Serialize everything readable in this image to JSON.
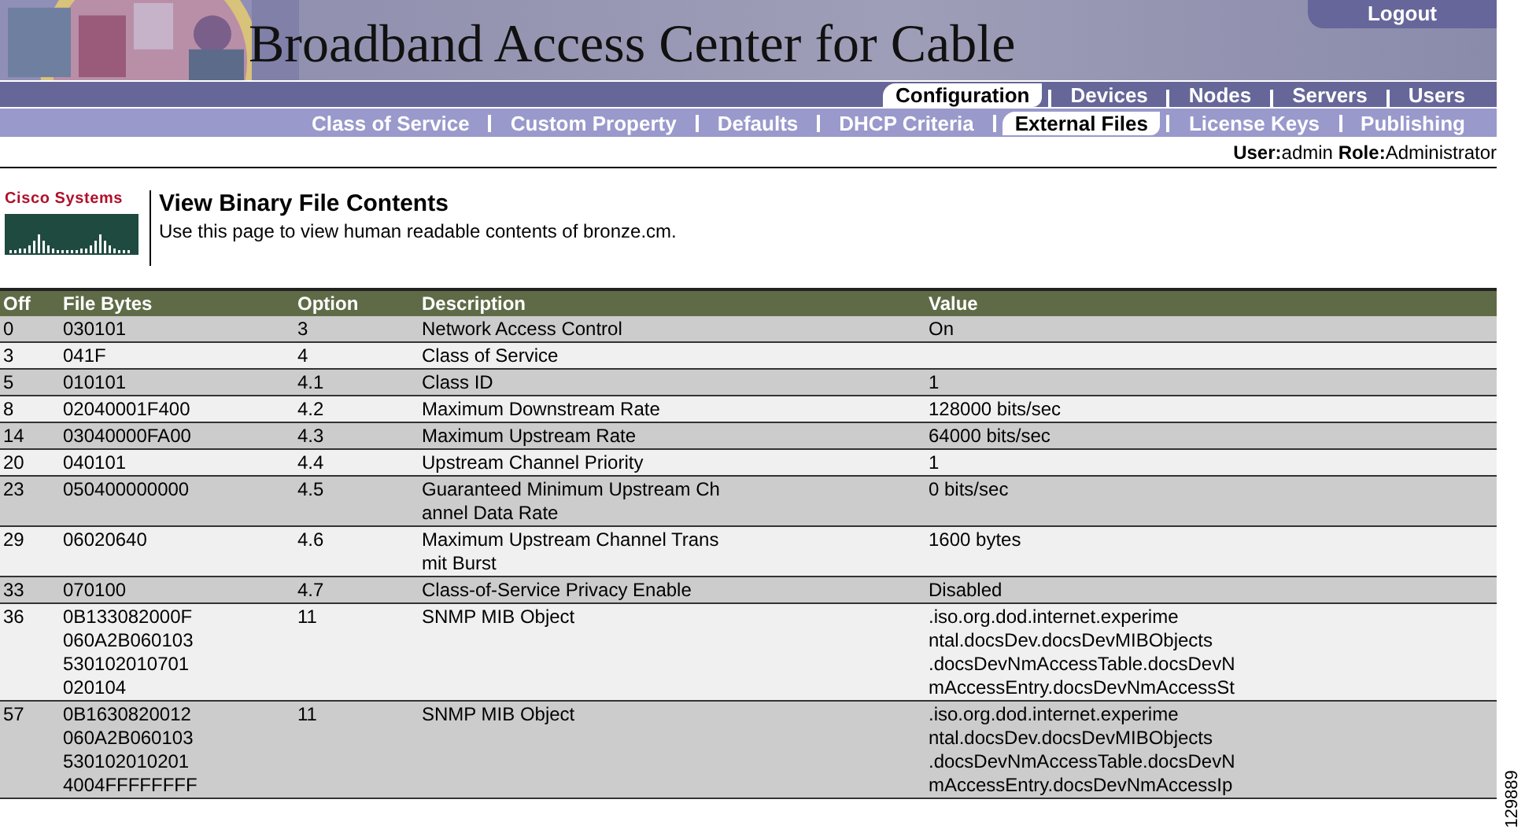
{
  "header": {
    "title": "Broadband Access Center for Cable",
    "logout": "Logout"
  },
  "main_tabs": [
    {
      "label": "Configuration",
      "selected": true
    },
    {
      "label": "Devices",
      "selected": false
    },
    {
      "label": "Nodes",
      "selected": false
    },
    {
      "label": "Servers",
      "selected": false
    },
    {
      "label": "Users",
      "selected": false
    }
  ],
  "sub_tabs": [
    {
      "label": "Class of Service",
      "selected": false
    },
    {
      "label": "Custom Property",
      "selected": false
    },
    {
      "label": "Defaults",
      "selected": false
    },
    {
      "label": "DHCP Criteria",
      "selected": false
    },
    {
      "label": "External Files",
      "selected": true
    },
    {
      "label": "License Keys",
      "selected": false
    },
    {
      "label": "Publishing",
      "selected": false
    }
  ],
  "user_line": {
    "user_label": "User:",
    "user": "admin",
    "role_label": "Role:",
    "role": "Administrator"
  },
  "logo": {
    "text": "Cisco Systems"
  },
  "page": {
    "title": "View Binary File Contents",
    "description": "Use this page to view human readable contents of bronze.cm."
  },
  "table": {
    "columns": [
      "Off",
      "File Bytes",
      "Option",
      "Description",
      "Value"
    ],
    "rows": [
      {
        "off": "0",
        "bytes": [
          "030101"
        ],
        "option": "3",
        "description": [
          "Network Access Control"
        ],
        "value": [
          "On"
        ]
      },
      {
        "off": "3",
        "bytes": [
          "041F"
        ],
        "option": "4",
        "description": [
          "Class of Service"
        ],
        "value": []
      },
      {
        "off": "5",
        "bytes": [
          "010101"
        ],
        "option": "4.1",
        "description": [
          "Class ID"
        ],
        "value": [
          "1"
        ]
      },
      {
        "off": "8",
        "bytes": [
          "02040001F400"
        ],
        "option": "4.2",
        "description": [
          "Maximum Downstream Rate"
        ],
        "value": [
          "128000 bits/sec"
        ]
      },
      {
        "off": "14",
        "bytes": [
          "03040000FA00"
        ],
        "option": "4.3",
        "description": [
          "Maximum Upstream Rate"
        ],
        "value": [
          "64000 bits/sec"
        ]
      },
      {
        "off": "20",
        "bytes": [
          "040101"
        ],
        "option": "4.4",
        "description": [
          "Upstream Channel Priority"
        ],
        "value": [
          "1"
        ]
      },
      {
        "off": "23",
        "bytes": [
          "050400000000"
        ],
        "option": "4.5",
        "description": [
          "Guaranteed Minimum Upstream Ch",
          "annel Data Rate"
        ],
        "value": [
          "0 bits/sec"
        ]
      },
      {
        "off": "29",
        "bytes": [
          "06020640"
        ],
        "option": "4.6",
        "description": [
          "Maximum Upstream Channel Trans",
          "mit Burst"
        ],
        "value": [
          "1600 bytes"
        ]
      },
      {
        "off": "33",
        "bytes": [
          "070100"
        ],
        "option": "4.7",
        "description": [
          "Class-of-Service Privacy Enable"
        ],
        "value": [
          "Disabled"
        ]
      },
      {
        "off": "36",
        "bytes": [
          "0B133082000F",
          "060A2B060103",
          "530102010701",
          "020104"
        ],
        "option": "11",
        "description": [
          "SNMP MIB Object"
        ],
        "value": [
          ".iso.org.dod.internet.experime",
          "ntal.docsDev.docsDevMIBObjects",
          ".docsDevNmAccessTable.docsDevN",
          "mAccessEntry.docsDevNmAccessSt"
        ]
      },
      {
        "off": "57",
        "bytes": [
          "0B1630820012",
          "060A2B060103",
          "530102010201",
          "4004FFFFFFFF"
        ],
        "option": "11",
        "description": [
          "SNMP MIB Object"
        ],
        "value": [
          ".iso.org.dod.internet.experime",
          "ntal.docsDev.docsDevMIBObjects",
          ".docsDevNmAccessTable.docsDevN",
          "mAccessEntry.docsDevNmAccessIp"
        ]
      }
    ]
  },
  "figure_id": "129889"
}
